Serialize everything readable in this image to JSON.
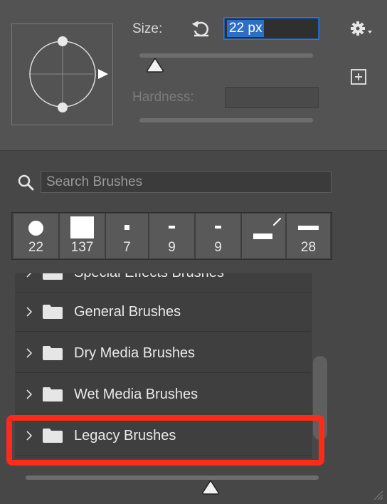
{
  "brush_settings": {
    "size_label": "Size:",
    "size_value": "22 px",
    "hardness_label": "Hardness:",
    "hardness_value": "",
    "reset_icon": "reset-icon",
    "settings_icon": "gear-icon",
    "new_preset_icon": "add-icon"
  },
  "search": {
    "placeholder": "Search Brushes",
    "icon": "search-icon"
  },
  "recent_brushes": [
    {
      "size": "22",
      "shape": "round"
    },
    {
      "size": "137",
      "shape": "square"
    },
    {
      "size": "7",
      "shape": "small-square"
    },
    {
      "size": "9",
      "shape": "dash"
    },
    {
      "size": "9",
      "shape": "dash"
    },
    {
      "size": "",
      "shape": "brush-bar"
    },
    {
      "size": "28",
      "shape": "bar"
    }
  ],
  "brush_groups": [
    {
      "label": "Special Effects Brushes",
      "icon": "folder-icon"
    },
    {
      "label": "General Brushes",
      "icon": "folder-icon"
    },
    {
      "label": "Dry Media Brushes",
      "icon": "folder-icon"
    },
    {
      "label": "Wet Media Brushes",
      "icon": "folder-icon"
    },
    {
      "label": "Legacy Brushes",
      "icon": "folder-icon"
    }
  ],
  "highlighted_group": "Legacy Brushes",
  "colors": {
    "panel": "#535353",
    "list_bg": "#3f3f3f",
    "selection": "#2d6fc6",
    "highlight": "#ff2a1a"
  }
}
